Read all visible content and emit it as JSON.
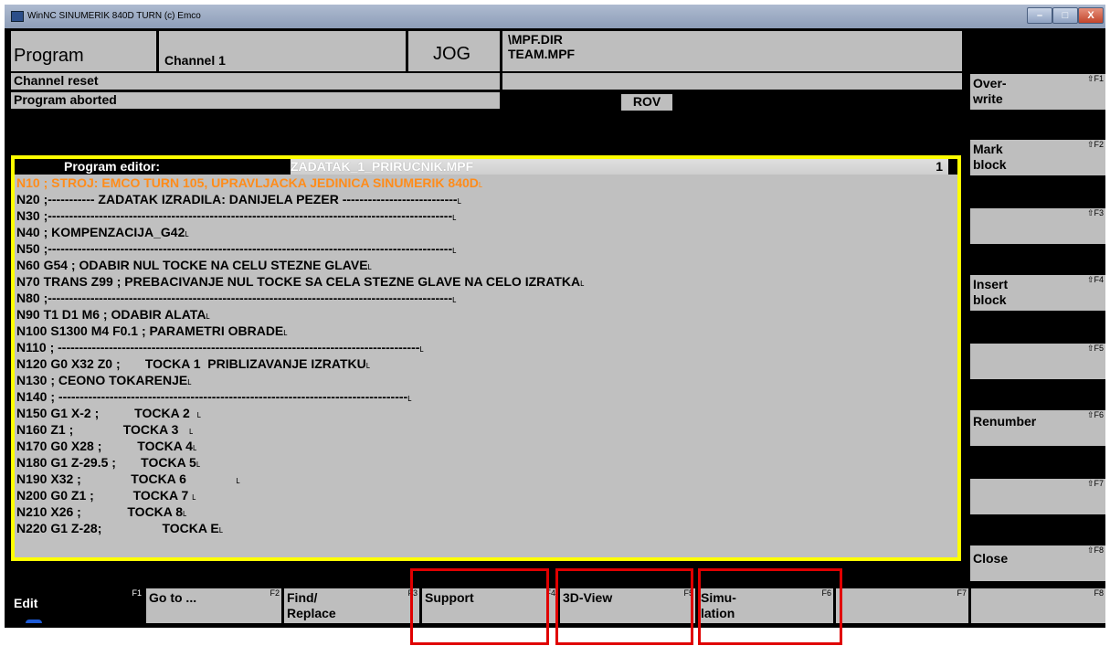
{
  "window": {
    "title": "WinNC SINUMERIK 840D TURN (c) Emco",
    "min": "–",
    "max": "□",
    "close": "X"
  },
  "status": {
    "area": "Program",
    "channel": "Channel 1",
    "mode": "JOG",
    "dir": "\\MPF.DIR",
    "file": "TEAM.MPF",
    "msg1": "Channel reset",
    "msg2": "Program aborted",
    "rov": "ROV"
  },
  "editor": {
    "label": "Program editor:",
    "filename": "ZADATAK_1_PRIRUCNIK.MPF",
    "line_no": "1",
    "lines": [
      "N10 ; STROJ: EMCO TURN 105, UPRAVLJACKA JEDINICA SINUMERIK 840D˪",
      "N20 ;----------- ZADATAK IZRADILA: DANIJELA PEZER ---------------------------˪",
      "N30 ;-----------------------------------------------------------------------------------------------˪",
      "N40 ; KOMPENZACIJA_G42˪",
      "N50 ;-----------------------------------------------------------------------------------------------˪",
      "N60 G54 ; ODABIR NUL TOCKE NA CELU STEZNE GLAVE˪",
      "N70 TRANS Z99 ; PREBACIVANJE NUL TOCKE SA CELA STEZNE GLAVE NA CELO IZRATKA˪",
      "N80 ;-----------------------------------------------------------------------------------------------˪",
      "N90 T1 D1 M6 ; ODABIR ALATA˪",
      "N100 S1300 M4 F0.1 ; PARAMETRI OBRADE˪",
      "N110 ; -------------------------------------------------------------------------------------˪",
      "N120 G0 X32 Z0 ;       TOCKA 1  PRIBLIZAVANJE IZRATKU˪",
      "N130 ; CEONO TOKARENJE˪",
      "N140 ; ----------------------------------------------------------------------------------˪",
      "N150 G1 X-2 ;          TOCKA 2  ˪",
      "N160 Z1 ;              TOCKA 3   ˪",
      "N170 G0 X28 ;          TOCKA 4˪",
      "N180 G1 Z-29.5 ;       TOCKA 5˪",
      "N190 X32 ;              TOCKA 6              ˪",
      "N200 G0 Z1 ;           TOCKA 7 ˪",
      "N210 X26 ;             TOCKA 8˪",
      "N220 G1 Z-28;                 TOCKA E˪"
    ]
  },
  "vsoft": [
    {
      "label": "Over-\nwrite",
      "key": "⇧F1"
    },
    {
      "label": "Mark\nblock",
      "key": "⇧F2"
    },
    {
      "label": "",
      "key": "⇧F3"
    },
    {
      "label": "Insert\nblock",
      "key": "⇧F4"
    },
    {
      "label": "",
      "key": "⇧F5"
    },
    {
      "label": "Renumber",
      "key": "⇧F6"
    },
    {
      "label": "",
      "key": "⇧F7"
    },
    {
      "label": "Close",
      "key": "⇧F8"
    }
  ],
  "hsoft": [
    {
      "label": "Edit",
      "key": "F1"
    },
    {
      "label": "Go to ...",
      "key": "F2"
    },
    {
      "label": "Find/\nReplace",
      "key": "F3"
    },
    {
      "label": "Support",
      "key": "F4"
    },
    {
      "label": "3D-View",
      "key": "F5"
    },
    {
      "label": "Simu-\nlation",
      "key": "F6"
    },
    {
      "label": "",
      "key": "F7"
    },
    {
      "label": "",
      "key": "F8"
    }
  ],
  "colors": {
    "highlight_line": "#ff8c1a",
    "editor_border": "#ffff00",
    "annotation": "#e00000"
  }
}
